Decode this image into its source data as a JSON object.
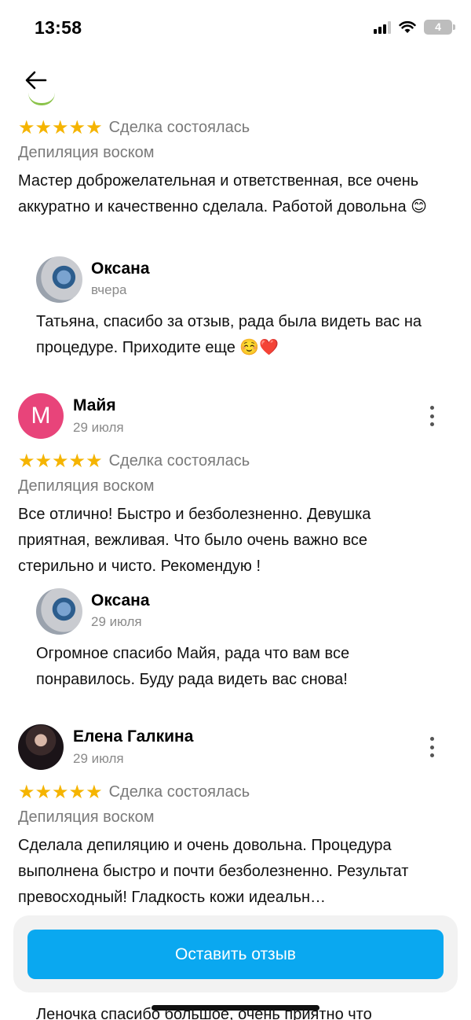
{
  "status_bar": {
    "time": "13:58",
    "battery": "4"
  },
  "reviews": [
    {
      "stars": "★★★★★",
      "deal": "Сделка состоялась",
      "service": "Депиляция воском",
      "text": "Мастер доброжелательная и ответственная, все очень аккуратно и качественно сделала. Работой довольна 😊",
      "reply": {
        "name": "Оксана",
        "date": "вчера",
        "text": "Татьяна, спасибо за отзыв, рада была видеть вас на процедуре. Приходите еще ☺️❤️"
      }
    },
    {
      "avatar_letter": "М",
      "name": "Майя",
      "date": "29 июля",
      "stars": "★★★★★",
      "deal": "Сделка состоялась",
      "service": "Депиляция воском",
      "text": "Все отлично! Быстро и безболезненно. Девушка приятная, вежливая. Что было очень важно все стерильно и чисто. Рекомендую !",
      "reply": {
        "name": "Оксана",
        "date": "29 июля",
        "text": "Огромное спасибо Майя, рада что вам все понравилось. Буду рада видеть вас снова!"
      }
    },
    {
      "name": "Елена Галкина",
      "date": "29 июля",
      "stars": "★★★★★",
      "deal": "Сделка состоялась",
      "service": "Депиляция воском",
      "text": "Сделала депиляцию и очень довольна. Процедура выполнена быстро и почти безболезненно. Результат превосходный! Гладкость кожи идеальн…"
    }
  ],
  "leave_review_label": "Оставить отзыв",
  "peek_text": "Леночка спасибо большое, очень приятно что",
  "colors": {
    "accent": "#0aa8f0",
    "stars": "#f5b400",
    "avatar_letter_bg": "#e8447a"
  }
}
